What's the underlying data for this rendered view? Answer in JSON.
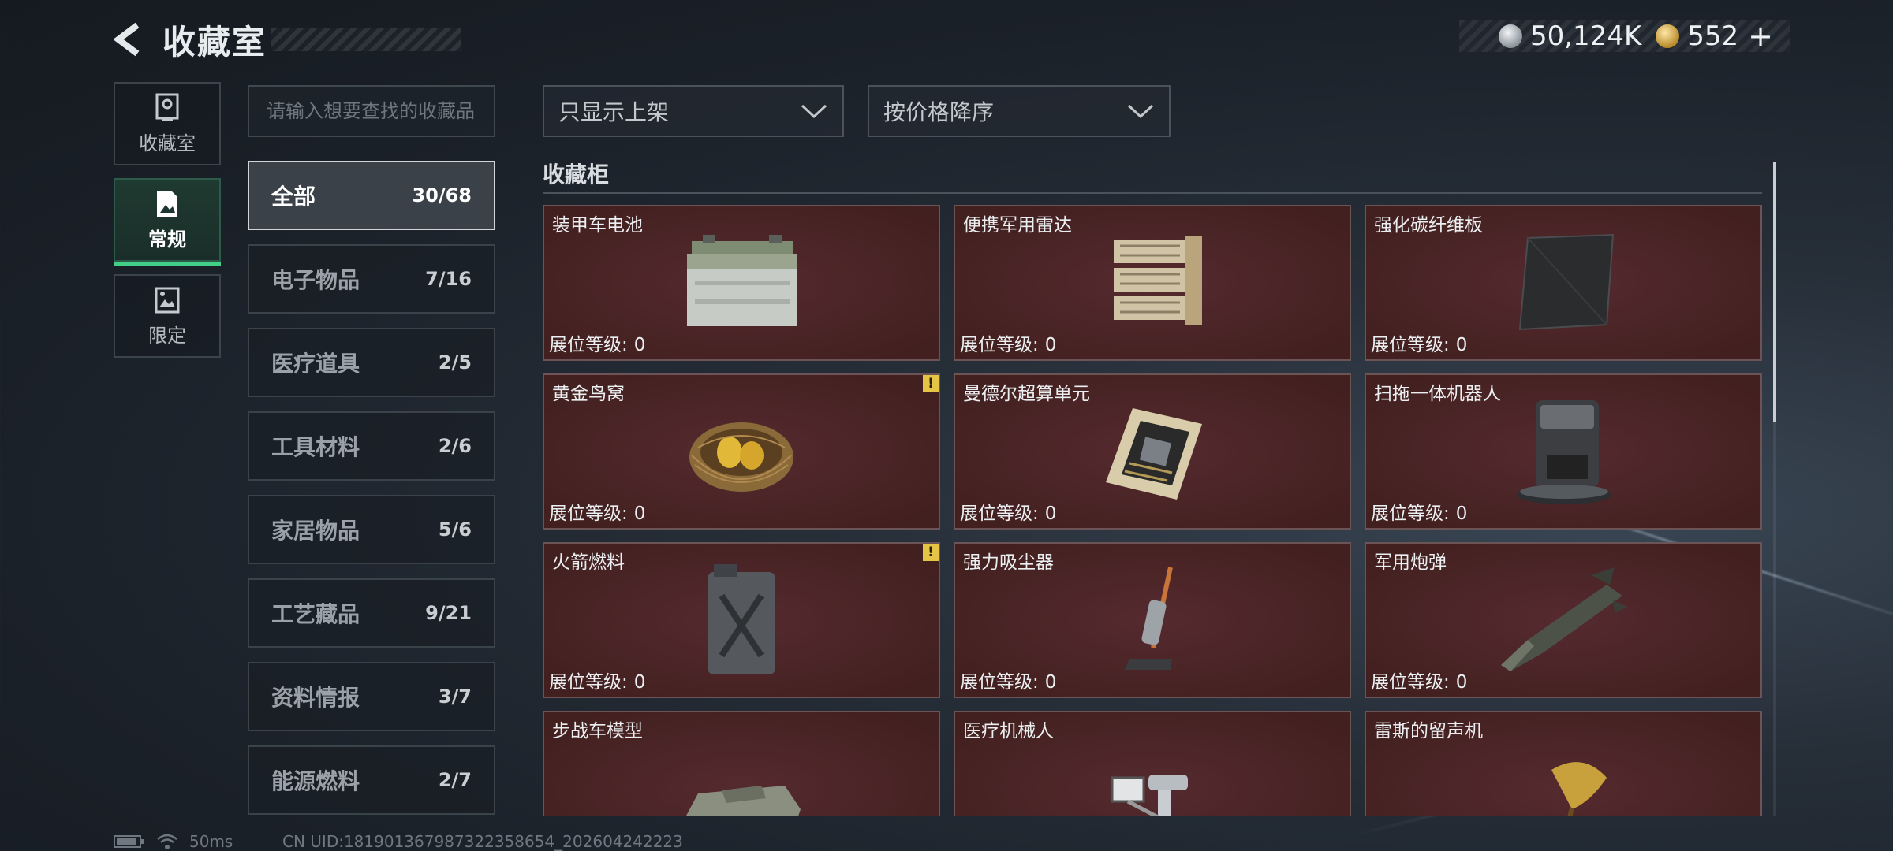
{
  "header": {
    "title": "收藏室",
    "currency": [
      {
        "icon": "silver-coin-icon",
        "value": "50,124K"
      },
      {
        "icon": "gold-coin-icon",
        "value": "552"
      }
    ],
    "plus": "+"
  },
  "nav": [
    {
      "label": "收藏室",
      "icon": "trophy-case-icon"
    },
    {
      "label": "常规",
      "icon": "picture-document-icon",
      "active": true
    },
    {
      "label": "限定",
      "icon": "limited-picture-icon"
    }
  ],
  "search": {
    "placeholder": "请输入想要查找的收藏品"
  },
  "categories": [
    {
      "name": "全部",
      "count": "30/68",
      "active": true
    },
    {
      "name": "电子物品",
      "count": "7/16"
    },
    {
      "name": "医疗道具",
      "count": "2/5"
    },
    {
      "name": "工具材料",
      "count": "2/6"
    },
    {
      "name": "家居物品",
      "count": "5/6"
    },
    {
      "name": "工艺藏品",
      "count": "9/21"
    },
    {
      "name": "资料情报",
      "count": "3/7"
    },
    {
      "name": "能源燃料",
      "count": "2/7"
    }
  ],
  "filters": {
    "shelf": "只显示上架",
    "sort": "按价格降序"
  },
  "cabinet": {
    "title": "收藏柜",
    "level_label": "展位等级:",
    "items": [
      {
        "name": "装甲车电池",
        "level": "0",
        "icon": "car-battery-icon"
      },
      {
        "name": "便携军用雷达",
        "level": "0",
        "icon": "radar-icon"
      },
      {
        "name": "强化碳纤维板",
        "level": "0",
        "icon": "carbon-plate-icon"
      },
      {
        "name": "黄金鸟窝",
        "level": "0",
        "icon": "golden-nest-icon",
        "alert": "!"
      },
      {
        "name": "曼德尔超算单元",
        "level": "0",
        "icon": "compute-unit-icon"
      },
      {
        "name": "扫拖一体机器人",
        "level": "0",
        "icon": "robot-vacuum-icon"
      },
      {
        "name": "火箭燃料",
        "level": "0",
        "icon": "fuel-canister-icon",
        "alert": "!"
      },
      {
        "name": "强力吸尘器",
        "level": "0",
        "icon": "vacuum-cleaner-icon"
      },
      {
        "name": "军用炮弹",
        "level": "0",
        "icon": "artillery-shell-icon"
      },
      {
        "name": "步战车模型",
        "level": "",
        "icon": "ifv-model-icon"
      },
      {
        "name": "医疗机械人",
        "level": "",
        "icon": "medical-robot-icon"
      },
      {
        "name": "雷斯的留声机",
        "level": "",
        "icon": "gramophone-icon"
      }
    ]
  },
  "footer": {
    "ping": "50ms",
    "uid": "CN UID:181901367987322358654_202604242223"
  }
}
